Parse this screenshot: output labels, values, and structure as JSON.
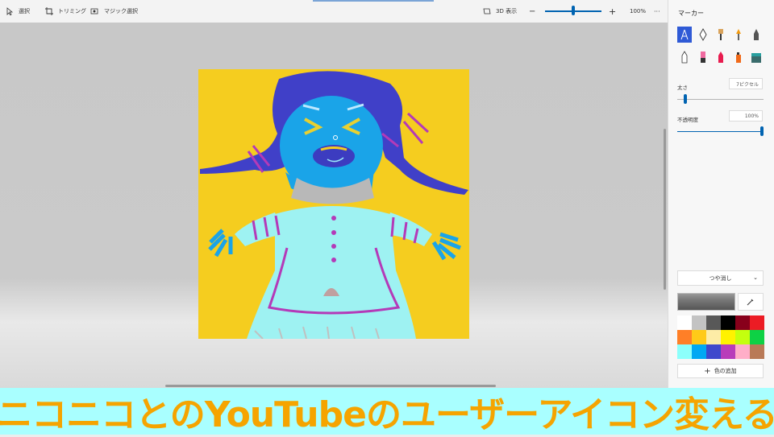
{
  "toolbar": {
    "select_label": "選択",
    "crop_label": "トリミング",
    "magic_select_label": "マジック選択",
    "view_3d_label": "3D 表示",
    "zoom_minus": "−",
    "zoom_plus": "+",
    "zoom_value": "100%",
    "more": "···"
  },
  "panel": {
    "title": "マーカー",
    "tools": [
      "calligraphy-pen-icon",
      "ink-pen-icon",
      "oil-brush-icon",
      "watercolor-icon",
      "pixel-pen-icon",
      "pencil-icon",
      "eraser-icon",
      "crayon-icon",
      "spray-can-icon",
      "fill-bucket-icon"
    ],
    "size_label": "太さ",
    "size_value": "7ピクセル",
    "size_fraction": 0.08,
    "opacity_label": "不透明度",
    "opacity_value": "100%",
    "opacity_fraction": 1.0,
    "finish_value": "つや消し",
    "add_color_label": "色の追加",
    "palette": [
      "#ffffff",
      "#c3c3c3",
      "#585858",
      "#000000",
      "#88001b",
      "#ec1c24",
      "#ff7f27",
      "#ffca18",
      "#fdeca6",
      "#fff200",
      "#c4ff0e",
      "#0ed145",
      "#8cfffb",
      "#00a8f3",
      "#3f48cc",
      "#b83dba",
      "#ffaec8",
      "#b97a57"
    ]
  },
  "caption": {
    "text": "ニコニコとのYouTubeのユーザーアイコン変える"
  }
}
